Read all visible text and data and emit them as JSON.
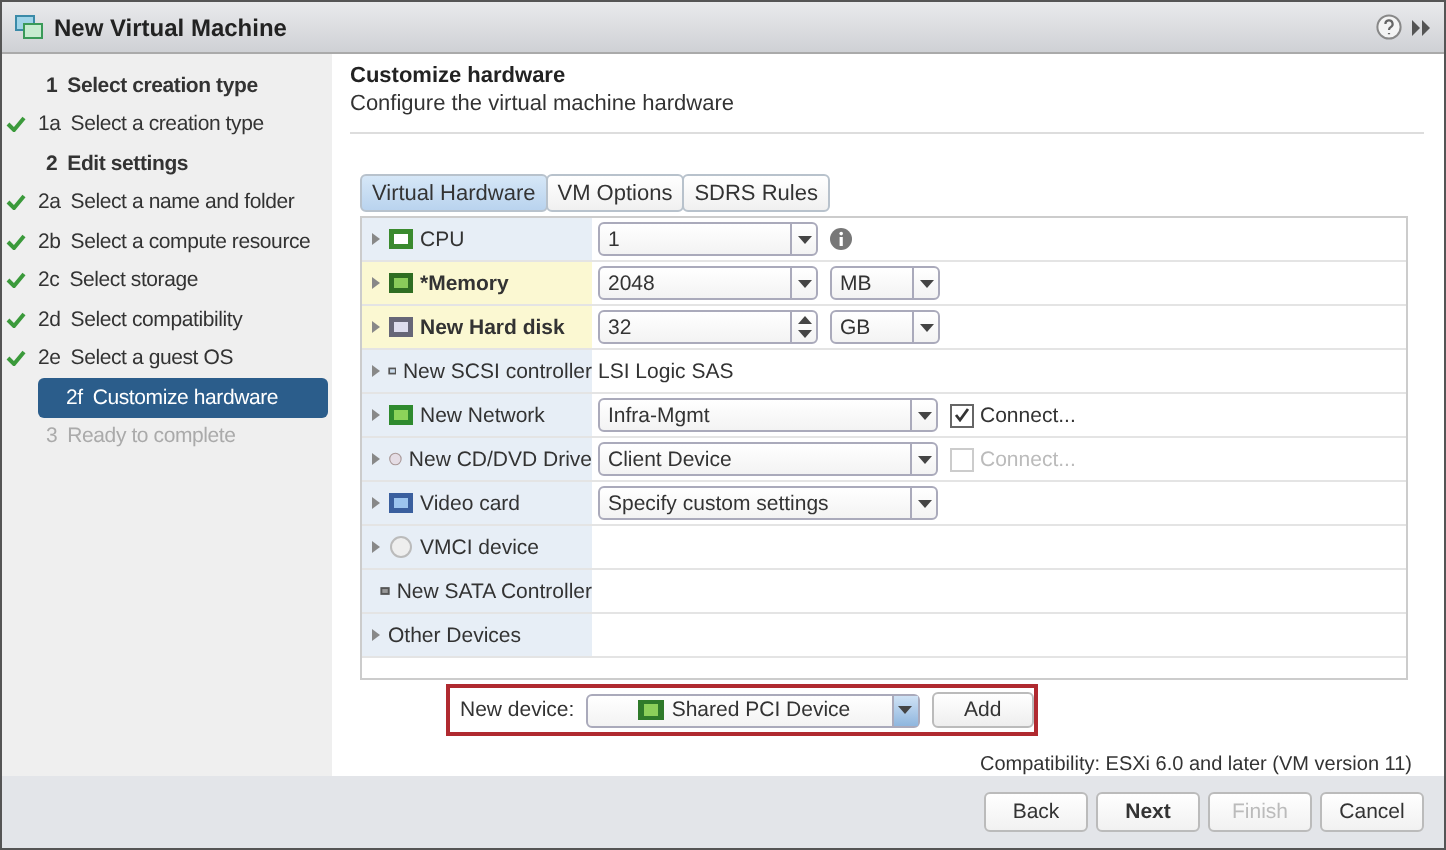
{
  "window": {
    "title": "New Virtual Machine"
  },
  "steps": [
    {
      "kind": "group",
      "number": "1",
      "label": "Select creation type",
      "done": false,
      "selected": false,
      "disabled": false
    },
    {
      "kind": "step",
      "number": "1a",
      "label": "Select a creation type",
      "done": true,
      "selected": false,
      "disabled": false
    },
    {
      "kind": "group",
      "number": "2",
      "label": "Edit settings",
      "done": false,
      "selected": false,
      "disabled": false
    },
    {
      "kind": "step",
      "number": "2a",
      "label": "Select a name and folder",
      "done": true,
      "selected": false,
      "disabled": false
    },
    {
      "kind": "step",
      "number": "2b",
      "label": "Select a compute resource",
      "done": true,
      "selected": false,
      "disabled": false
    },
    {
      "kind": "step",
      "number": "2c",
      "label": "Select storage",
      "done": true,
      "selected": false,
      "disabled": false
    },
    {
      "kind": "step",
      "number": "2d",
      "label": "Select compatibility",
      "done": true,
      "selected": false,
      "disabled": false
    },
    {
      "kind": "step",
      "number": "2e",
      "label": "Select a guest OS",
      "done": true,
      "selected": false,
      "disabled": false
    },
    {
      "kind": "step",
      "number": "2f",
      "label": "Customize hardware",
      "done": false,
      "selected": true,
      "disabled": false
    },
    {
      "kind": "group",
      "number": "3",
      "label": "Ready to complete",
      "done": false,
      "selected": false,
      "disabled": true
    }
  ],
  "header": {
    "title": "Customize hardware",
    "subtitle": "Configure the virtual machine hardware"
  },
  "tabs": [
    {
      "label": "Virtual Hardware",
      "selected": true
    },
    {
      "label": "VM Options",
      "selected": false
    },
    {
      "label": "SDRS Rules",
      "selected": false
    }
  ],
  "hardware": [
    {
      "name": "CPU",
      "bold": false,
      "highlighted": false,
      "expandable": true,
      "control": {
        "kind": "select",
        "value": "1"
      },
      "info": true
    },
    {
      "name": "*Memory",
      "bold": true,
      "highlighted": true,
      "expandable": true,
      "control": {
        "kind": "select",
        "value": "2048"
      },
      "unit": "MB"
    },
    {
      "name": "New Hard disk",
      "bold": true,
      "highlighted": true,
      "expandable": true,
      "control": {
        "kind": "spinner",
        "value": "32"
      },
      "unit": "GB"
    },
    {
      "name": "New SCSI controller",
      "bold": false,
      "highlighted": false,
      "expandable": true,
      "control": {
        "kind": "text",
        "value": "LSI Logic SAS"
      }
    },
    {
      "name": "New Network",
      "bold": false,
      "highlighted": false,
      "expandable": true,
      "control": {
        "kind": "wide",
        "value": "Infra-Mgmt"
      },
      "connect": {
        "label": "Connect...",
        "checked": true,
        "disabled": false
      }
    },
    {
      "name": "New CD/DVD Drive",
      "bold": false,
      "highlighted": false,
      "expandable": true,
      "control": {
        "kind": "wide",
        "value": "Client Device"
      },
      "connect": {
        "label": "Connect...",
        "checked": false,
        "disabled": true
      }
    },
    {
      "name": "Video card",
      "bold": false,
      "highlighted": false,
      "expandable": true,
      "control": {
        "kind": "wide",
        "value": "Specify custom settings"
      }
    },
    {
      "name": "VMCI device",
      "bold": false,
      "highlighted": false,
      "expandable": true
    },
    {
      "name": "New SATA Controller",
      "bold": false,
      "highlighted": false,
      "expandable": false
    },
    {
      "name": "Other Devices",
      "bold": false,
      "highlighted": false,
      "expandable": true
    }
  ],
  "new_device": {
    "label": "New device:",
    "value": "Shared PCI Device",
    "button": "Add"
  },
  "compatibility": "Compatibility: ESXi 6.0 and later (VM version 11)",
  "buttons": [
    {
      "label": "Back",
      "primary": false,
      "disabled": false
    },
    {
      "label": "Next",
      "primary": true,
      "disabled": false
    },
    {
      "label": "Finish",
      "primary": false,
      "disabled": true
    },
    {
      "label": "Cancel",
      "primary": false,
      "disabled": false
    }
  ]
}
